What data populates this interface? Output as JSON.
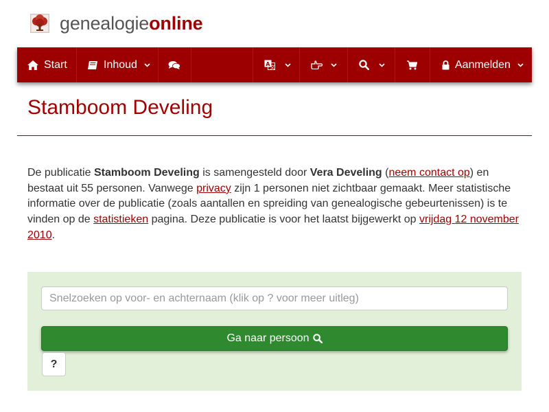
{
  "brand": {
    "name_part1": "genealogie",
    "name_part2": "online",
    "color_primary": "#9d0000",
    "color_success": "#2f8a2f"
  },
  "navbar": {
    "items": [
      {
        "icon": "home-icon",
        "label": "Start"
      },
      {
        "icon": "book-icon",
        "label": "Inhoud",
        "dropdown": true
      },
      {
        "icon": "chat-icon",
        "label": ""
      },
      {
        "icon": "language-icon",
        "label": "",
        "dropdown": true
      },
      {
        "icon": "hand-pointer-icon",
        "label": "",
        "dropdown": true
      },
      {
        "icon": "search-icon",
        "label": "",
        "dropdown": true
      },
      {
        "icon": "cart-icon",
        "label": ""
      },
      {
        "icon": "lock-icon",
        "label": "Aanmelden",
        "dropdown": true
      }
    ]
  },
  "page": {
    "title": "Stamboom Develing"
  },
  "intro": {
    "t1": "De publicatie ",
    "pub_name": "Stamboom Develing",
    "t2": " is samengesteld door ",
    "author": "Vera Develing",
    "t3": " (",
    "contact_link": "neem contact op",
    "t4": ") en bestaat uit 55 personen. Vanwege ",
    "privacy_link": "privacy",
    "t5": " zijn 1 personen niet zichtbaar gemaakt. Meer statistische informatie over de publicatie (zoals aantallen en spreiding van genealogische gebeurtenissen) is te vinden op de ",
    "stats_link": "statistieken",
    "t6": " pagina. Deze publicatie is voor het laatst bijgewerkt op ",
    "date_link": "vrijdag 12 november 2010",
    "t7": "."
  },
  "search": {
    "placeholder": "Snelzoeken op voor- en achternaam (klik op ? voor meer uitleg)",
    "value": "",
    "go_label": "Ga naar persoon",
    "help_label": "?"
  }
}
